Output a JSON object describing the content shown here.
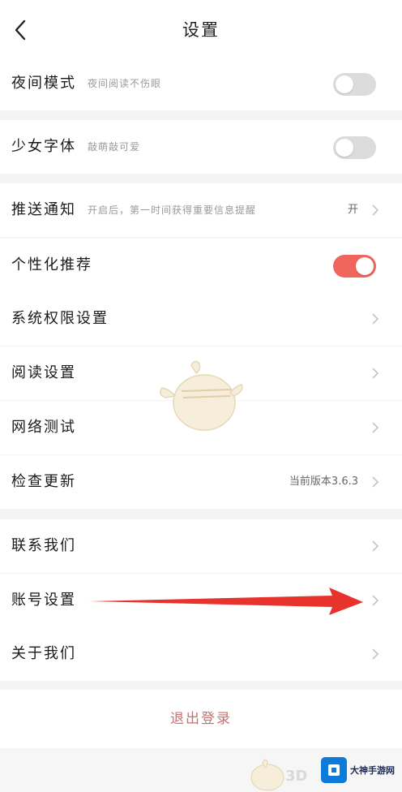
{
  "header": {
    "title": "设置"
  },
  "colors": {
    "accent": "#f0655d",
    "toggle_off": "#dcdcdc",
    "logout_text": "#c9706b"
  },
  "rows": {
    "night_mode": {
      "label": "夜间模式",
      "sub": "夜间阅读不伤眼",
      "toggle": "off"
    },
    "girl_font": {
      "label": "少女字体",
      "sub": "敲萌敲可爱",
      "toggle": "off"
    },
    "push": {
      "label": "推送通知",
      "sub": "开启后，第一时间获得重要信息提醒",
      "value": "开"
    },
    "personal": {
      "label": "个性化推荐",
      "toggle": "on"
    },
    "permissions": {
      "label": "系统权限设置"
    },
    "reading": {
      "label": "阅读设置"
    },
    "network": {
      "label": "网络测试"
    },
    "update": {
      "label": "检查更新",
      "value": "当前版本3.6.3"
    },
    "contact": {
      "label": "联系我们"
    },
    "account": {
      "label": "账号设置"
    },
    "about": {
      "label": "关于我们"
    }
  },
  "logout": {
    "label": "退出登录"
  },
  "watermark": {
    "brand": "大神手游网",
    "mark": "3D"
  }
}
